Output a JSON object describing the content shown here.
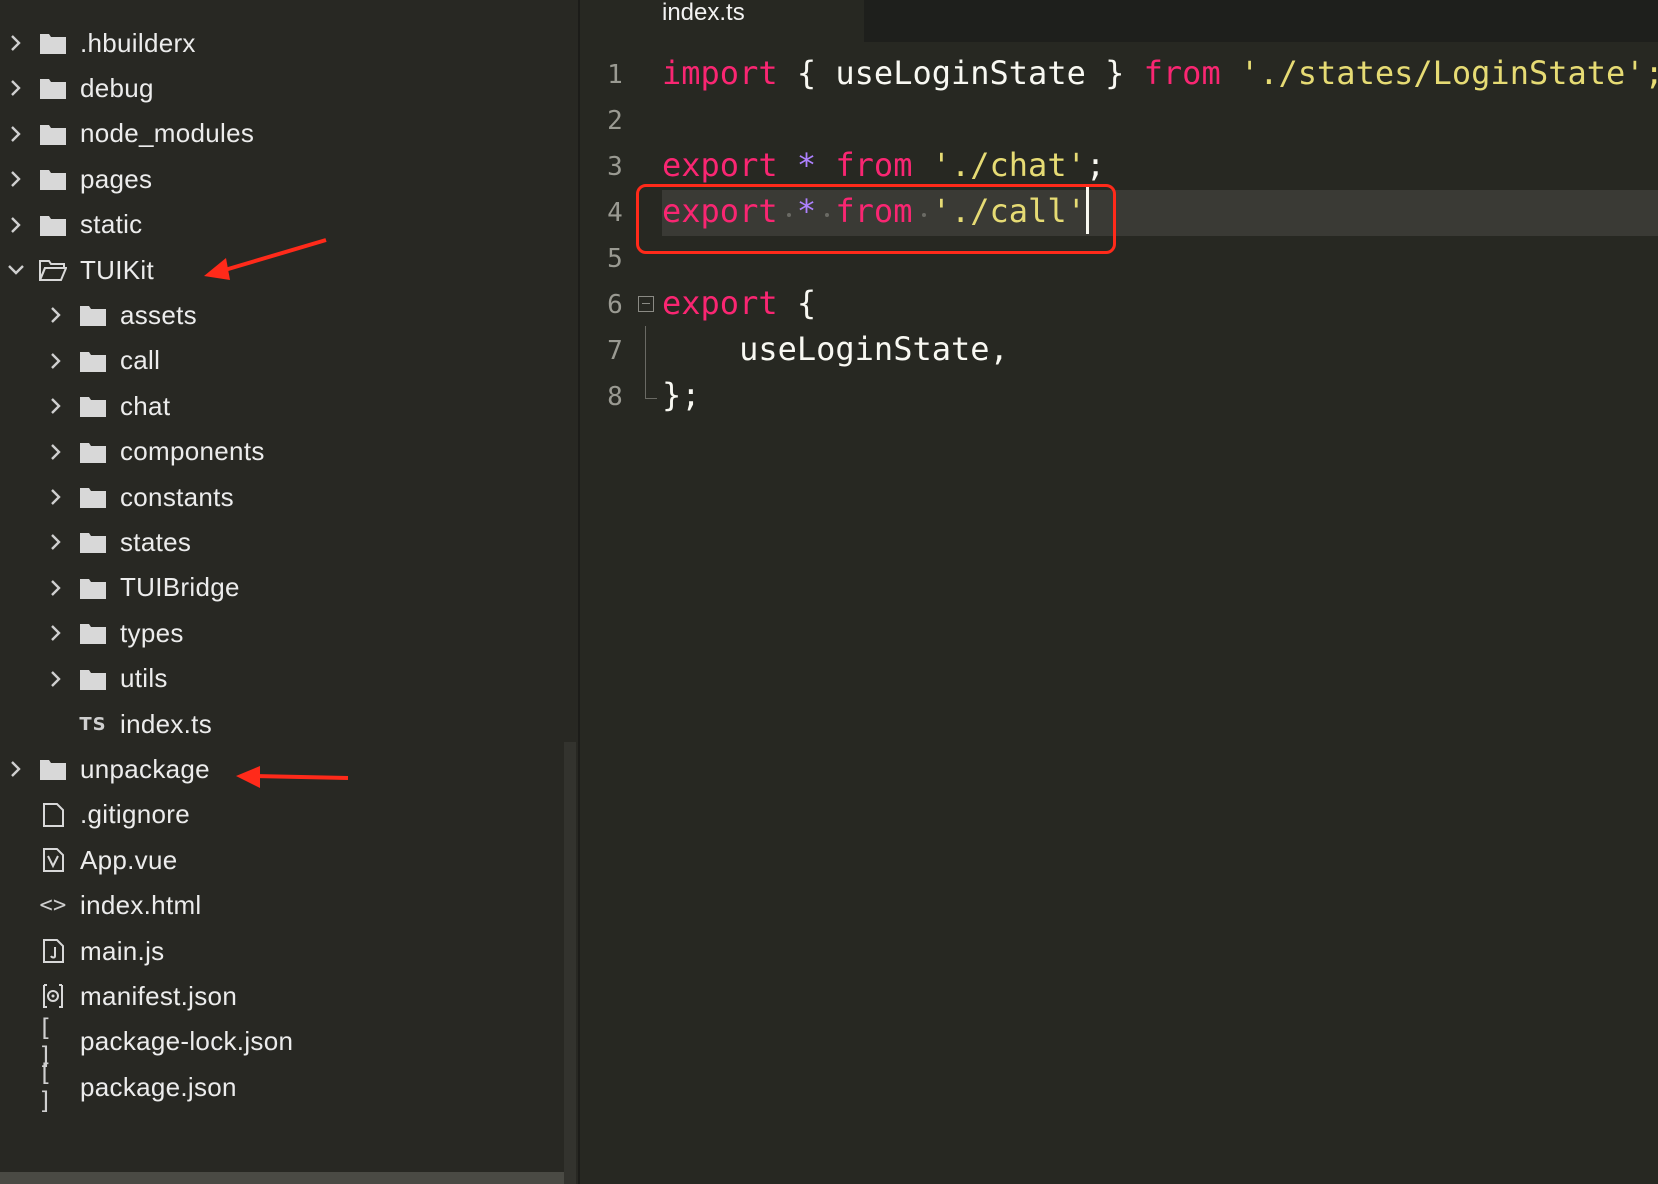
{
  "sidebar": {
    "items": [
      {
        "label": ".hbuilderx",
        "type": "folder",
        "expanded": false,
        "depth": 0
      },
      {
        "label": "debug",
        "type": "folder",
        "expanded": false,
        "depth": 0
      },
      {
        "label": "node_modules",
        "type": "folder",
        "expanded": false,
        "depth": 0
      },
      {
        "label": "pages",
        "type": "folder",
        "expanded": false,
        "depth": 0
      },
      {
        "label": "static",
        "type": "folder",
        "expanded": false,
        "depth": 0
      },
      {
        "label": "TUIKit",
        "type": "folder-open",
        "expanded": true,
        "depth": 0
      },
      {
        "label": "assets",
        "type": "folder",
        "expanded": false,
        "depth": 1
      },
      {
        "label": "call",
        "type": "folder",
        "expanded": false,
        "depth": 1
      },
      {
        "label": "chat",
        "type": "folder",
        "expanded": false,
        "depth": 1
      },
      {
        "label": "components",
        "type": "folder",
        "expanded": false,
        "depth": 1
      },
      {
        "label": "constants",
        "type": "folder",
        "expanded": false,
        "depth": 1
      },
      {
        "label": "states",
        "type": "folder",
        "expanded": false,
        "depth": 1
      },
      {
        "label": "TUIBridge",
        "type": "folder",
        "expanded": false,
        "depth": 1
      },
      {
        "label": "types",
        "type": "folder",
        "expanded": false,
        "depth": 1
      },
      {
        "label": "utils",
        "type": "folder",
        "expanded": false,
        "depth": 1
      },
      {
        "label": "index.ts",
        "type": "ts",
        "depth": 1,
        "icon_text": "TS"
      },
      {
        "label": "unpackage",
        "type": "folder",
        "expanded": false,
        "depth": 0
      },
      {
        "label": ".gitignore",
        "type": "file",
        "depth": 0
      },
      {
        "label": "App.vue",
        "type": "vue",
        "depth": 0
      },
      {
        "label": "index.html",
        "type": "html",
        "depth": 0,
        "icon_text": "<>"
      },
      {
        "label": "main.js",
        "type": "js",
        "depth": 0
      },
      {
        "label": "manifest.json",
        "type": "settings",
        "depth": 0
      },
      {
        "label": "package-lock.json",
        "type": "json",
        "depth": 0,
        "icon_text": "[ ]"
      },
      {
        "label": "package.json",
        "type": "json",
        "depth": 0,
        "icon_text": "[ ]"
      }
    ]
  },
  "editor": {
    "tab_label": "index.ts",
    "lines": [
      {
        "num": "1",
        "tokens": [
          [
            "kw",
            "import"
          ],
          [
            "plain",
            " { useLoginState } "
          ],
          [
            "kw",
            "from"
          ],
          [
            "plain",
            " "
          ],
          [
            "str",
            "'./states/LoginState';"
          ]
        ]
      },
      {
        "num": "2",
        "tokens": []
      },
      {
        "num": "3",
        "tokens": [
          [
            "kw",
            "export"
          ],
          [
            "plain",
            " "
          ],
          [
            "op",
            "*"
          ],
          [
            "plain",
            " "
          ],
          [
            "kw",
            "from"
          ],
          [
            "plain",
            " "
          ],
          [
            "str",
            "'./chat'"
          ],
          [
            "plain",
            ";"
          ]
        ]
      },
      {
        "num": "4",
        "tokens": [
          [
            "kw",
            "export"
          ],
          [
            "plain",
            " "
          ],
          [
            "op",
            "*"
          ],
          [
            "plain",
            " "
          ],
          [
            "kw",
            "from"
          ],
          [
            "plain",
            " "
          ],
          [
            "str",
            "'./call'"
          ]
        ]
      },
      {
        "num": "5",
        "tokens": []
      },
      {
        "num": "6",
        "tokens": [
          [
            "kw",
            "export"
          ],
          [
            "plain",
            " {"
          ]
        ]
      },
      {
        "num": "7",
        "tokens": [
          [
            "plain",
            "    useLoginState,"
          ]
        ]
      },
      {
        "num": "8",
        "tokens": [
          [
            "plain",
            "};"
          ]
        ]
      }
    ]
  },
  "colors": {
    "background": "#272822",
    "keyword": "#f92672",
    "operator": "#ae81ff",
    "string": "#e6db74",
    "annotation": "#ff2a1a"
  }
}
